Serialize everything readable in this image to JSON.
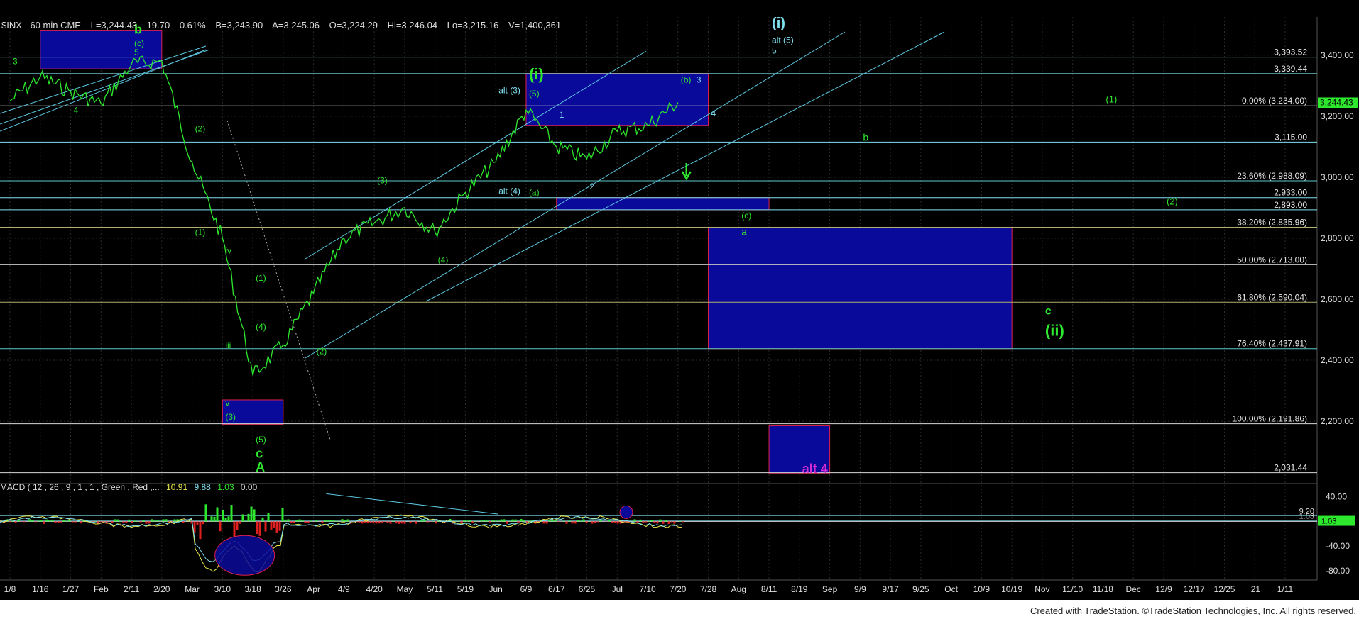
{
  "header": {
    "symbol": "$INX - 60 min  CME",
    "last": "L=3,244.43",
    "change": "19.70",
    "change_pct": "0.61%",
    "bid": "B=3,243.90",
    "ask": "A=3,245.06",
    "open": "O=3,224.29",
    "high": "Hi=3,246.04",
    "low": "Lo=3,215.16",
    "volume": "V=1,400,361"
  },
  "macd_header": {
    "label": "MACD ( 12 , 26 , 9 , 1 , 1 , Green , Red ,...",
    "v1": "10.91",
    "v2": "9.88",
    "v3": "1.03",
    "v4": "0.00"
  },
  "footer": "Created with TradeStation. ©TradeStation Technologies, Inc. All rights reserved.",
  "chart_data": {
    "type": "line",
    "x_tick_labels": [
      "1/8",
      "1/16",
      "1/27",
      "Feb",
      "2/11",
      "2/20",
      "Mar",
      "3/10",
      "3/18",
      "3/26",
      "Apr",
      "4/9",
      "4/20",
      "May",
      "5/11",
      "5/19",
      "Jun",
      "6/9",
      "6/17",
      "6/25",
      "Jul",
      "7/10",
      "7/20",
      "7/28",
      "Aug",
      "8/11",
      "8/19",
      "Sep",
      "9/9",
      "9/17",
      "9/25",
      "Oct",
      "10/9",
      "10/19",
      "Nov",
      "11/10",
      "11/18",
      "Dec",
      "12/9",
      "12/17",
      "12/25",
      "'21",
      "1/11"
    ],
    "price_axis": {
      "ticks": [
        3400,
        3200,
        3000,
        2800,
        2600,
        2400,
        2200
      ],
      "tick_labels": [
        "3,400.00",
        "3,200.00",
        "3,000.00",
        "2,800.00",
        "2,600.00",
        "2,400.00",
        "2,200.00"
      ],
      "ylim": [
        2005,
        3525
      ]
    },
    "macd_axis": {
      "ticks": [
        40,
        0,
        -40,
        -80
      ],
      "tick_labels": [
        "40.00",
        "",
        "-40.00",
        "-80.00"
      ],
      "ylim": [
        -95,
        50
      ]
    },
    "last_price_label": "3,244.43",
    "series": [
      {
        "color": "#2ee82e",
        "x": [
          "1/8",
          "1/16",
          "1/27",
          "Feb",
          "2/11",
          "2/20",
          "Mar",
          "3/10",
          "3/18",
          "3/26",
          "Apr",
          "4/9",
          "4/20",
          "May",
          "5/11",
          "5/19",
          "Jun",
          "6/9",
          "6/17",
          "6/25",
          "Jul",
          "7/10",
          "7/20"
        ],
        "values": [
          3250,
          3330,
          3280,
          3240,
          3370,
          3380,
          3050,
          2800,
          2350,
          2450,
          2620,
          2800,
          2850,
          2900,
          2820,
          2950,
          3050,
          3220,
          3100,
          3060,
          3150,
          3170,
          3245
        ]
      }
    ],
    "horizontal_levels": [
      {
        "value": 3393.52,
        "label": "3,393.52",
        "color": "#7fe0f0"
      },
      {
        "value": 3339.44,
        "label": "3,339.44",
        "color": "#7fe0f0"
      },
      {
        "value": 3234.0,
        "label": "0.00% (3,234.00)",
        "color": "#d7d7d7"
      },
      {
        "value": 3115.0,
        "label": "3,115.00",
        "color": "#7fe0f0"
      },
      {
        "value": 2988.09,
        "label": "23.60% (2,988.09)",
        "color": "#5cc7c7"
      },
      {
        "value": 2933.0,
        "label": "2,933.00",
        "color": "#7fe0f0"
      },
      {
        "value": 2893.0,
        "label": "2,893.00",
        "color": "#7fe0f0"
      },
      {
        "value": 2835.96,
        "label": "38.20% (2,835.96)",
        "color": "#b0b06e"
      },
      {
        "value": 2713.0,
        "label": "50.00% (2,713.00)",
        "color": "#c9c9c9"
      },
      {
        "value": 2590.04,
        "label": "61.80% (2,590.04)",
        "color": "#b0b06e"
      },
      {
        "value": 2437.91,
        "label": "76.40% (2,437.91)",
        "color": "#5cc7c7"
      },
      {
        "value": 2191.86,
        "label": "100.00% (2,191.86)",
        "color": "#d7d7d7"
      },
      {
        "value": 2031.44,
        "label": "2,031.44",
        "color": "#d7d7d7"
      }
    ],
    "macd_levels": [
      {
        "value": 9.2,
        "label": "9.20"
      },
      {
        "value": 1.03,
        "label": "1.03"
      }
    ],
    "target_boxes": [
      {
        "from": "1/16",
        "to": "2/20",
        "low": 3355,
        "high": 3480,
        "color": "#0a0a9a"
      },
      {
        "from": "6/9",
        "to": "7/28",
        "low": 3170,
        "high": 3340,
        "color": "#0a0a9a"
      },
      {
        "from": "6/17",
        "to": "8/11",
        "low": 2893,
        "high": 2933,
        "color": "#0a0a9a"
      },
      {
        "from": "7/28",
        "to": "10/19",
        "low": 2437.91,
        "high": 2835.96,
        "color": "#0a0a9a"
      },
      {
        "from": "3/10",
        "to": "3/26",
        "low": 2190,
        "high": 2270,
        "color": "#0a0a9a"
      },
      {
        "from": "8/11",
        "to": "Sep",
        "low": 2030,
        "high": 2185,
        "color": "#0a0a9a"
      }
    ],
    "annotations": [
      {
        "text": "b",
        "x": "2/11",
        "y": 3470,
        "color": "#2ee82e",
        "size": 18
      },
      {
        "text": "(c)",
        "x": "2/11",
        "y": 3430,
        "color": "#2ee82e",
        "size": 12
      },
      {
        "text": "5",
        "x": "2/11",
        "y": 3400,
        "color": "#2ee82e",
        "size": 12
      },
      {
        "text": "3",
        "x": "1/8",
        "y": 3370,
        "color": "#2ee82e",
        "size": 12
      },
      {
        "text": "4",
        "x": "1/27",
        "y": 3210,
        "color": "#2ee82e",
        "size": 12
      },
      {
        "text": "(2)",
        "x": "Mar",
        "y": 3150,
        "color": "#2ee82e",
        "size": 12
      },
      {
        "text": "(1)",
        "x": "Mar",
        "y": 2810,
        "color": "#2ee82e",
        "size": 12
      },
      {
        "text": "iv",
        "x": "3/10",
        "y": 2750,
        "color": "#2ee82e",
        "size": 12
      },
      {
        "text": "(1)",
        "x": "3/18",
        "y": 2660,
        "color": "#2ee82e",
        "size": 12
      },
      {
        "text": "(4)",
        "x": "3/18",
        "y": 2500,
        "color": "#2ee82e",
        "size": 12
      },
      {
        "text": "iii",
        "x": "3/10",
        "y": 2440,
        "color": "#2ee82e",
        "size": 12
      },
      {
        "text": "(2)",
        "x": "Apr",
        "y": 2420,
        "color": "#2ee82e",
        "size": 12
      },
      {
        "text": "v",
        "x": "3/10",
        "y": 2250,
        "color": "#2ee82e",
        "size": 12
      },
      {
        "text": "(3)",
        "x": "3/10",
        "y": 2205,
        "color": "#2ee82e",
        "size": 12
      },
      {
        "text": "(5)",
        "x": "3/18",
        "y": 2130,
        "color": "#2ee82e",
        "size": 12
      },
      {
        "text": "c",
        "x": "3/18",
        "y": 2080,
        "color": "#2ee82e",
        "size": 18
      },
      {
        "text": "A",
        "x": "3/18",
        "y": 2035,
        "color": "#2ee82e",
        "size": 18
      },
      {
        "text": "(3)",
        "x": "4/20",
        "y": 2980,
        "color": "#2ee82e",
        "size": 12
      },
      {
        "text": "(4)",
        "x": "5/11",
        "y": 2720,
        "color": "#2ee82e",
        "size": 12
      },
      {
        "text": "alt (3)",
        "x": "Jun",
        "y": 3275,
        "color": "#7fe0f0",
        "size": 12
      },
      {
        "text": "(i)",
        "x": "6/9",
        "y": 3320,
        "color": "#2ee82e",
        "size": 22
      },
      {
        "text": "(5)",
        "x": "6/9",
        "y": 3265,
        "color": "#2ee82e",
        "size": 12
      },
      {
        "text": "1",
        "x": "6/17",
        "y": 3195,
        "color": "#7fe0f0",
        "size": 12
      },
      {
        "text": "alt (4)",
        "x": "Jun",
        "y": 2945,
        "color": "#7fe0f0",
        "size": 12
      },
      {
        "text": "(a)",
        "x": "6/9",
        "y": 2940,
        "color": "#2ee82e",
        "size": 12
      },
      {
        "text": "2",
        "x": "6/25",
        "y": 2960,
        "color": "#7fe0f0",
        "size": 12
      },
      {
        "text": "(b)",
        "x": "7/20",
        "y": 3310,
        "color": "#2ee82e",
        "size": 12
      },
      {
        "text": "3",
        "x": "7/20",
        "y": 3310,
        "color": "#7fe0f0",
        "size": 12
      },
      {
        "text": "4",
        "x": "7/28",
        "y": 3200,
        "color": "#7fe0f0",
        "size": 12
      },
      {
        "text": "(i)",
        "x": "8/11",
        "y": 3490,
        "color": "#7fe0f0",
        "size": 20
      },
      {
        "text": "alt (5)",
        "x": "8/11",
        "y": 3440,
        "color": "#7fe0f0",
        "size": 12
      },
      {
        "text": "5",
        "x": "8/11",
        "y": 3405,
        "color": "#7fe0f0",
        "size": 12
      },
      {
        "text": "(1)",
        "x": "11/18",
        "y": 3245,
        "color": "#2ee82e",
        "size": 13
      },
      {
        "text": "b",
        "x": "9/9",
        "y": 3120,
        "color": "#2ee82e",
        "size": 14
      },
      {
        "text": "(2)",
        "x": "12/9",
        "y": 2910,
        "color": "#2ee82e",
        "size": 13
      },
      {
        "text": "(c)",
        "x": "Aug",
        "y": 2865,
        "color": "#2ee82e",
        "size": 12
      },
      {
        "text": "a",
        "x": "Aug",
        "y": 2810,
        "color": "#2ee82e",
        "size": 14
      },
      {
        "text": "c",
        "x": "Nov",
        "y": 2550,
        "color": "#2ee82e",
        "size": 16
      },
      {
        "text": "(ii)",
        "x": "Nov",
        "y": 2480,
        "color": "#2ee82e",
        "size": 22
      },
      {
        "text": "alt 4",
        "x": "8/19",
        "y": 2030,
        "color": "#d42cd4",
        "size": 18
      }
    ]
  }
}
